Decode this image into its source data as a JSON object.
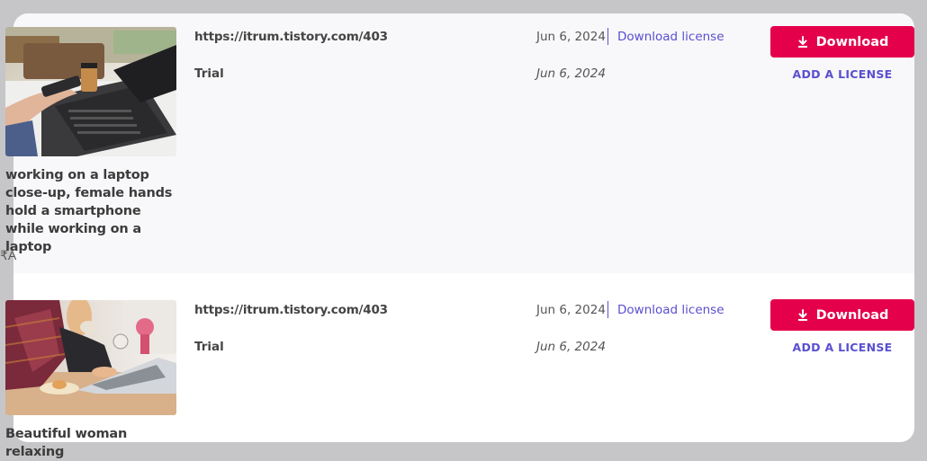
{
  "side_fragment": "₹A",
  "items": [
    {
      "url": "https://itrum.tistory.com/403",
      "date": "Jun 6, 2024",
      "download_license_label": "Download license",
      "license_type": "Trial",
      "license_date": "Jun 6, 2024",
      "download_button_label": "Download",
      "add_license_label": "ADD A LICENSE",
      "caption": "working on a laptop close-up, female hands hold a smartphone while working on a laptop"
    },
    {
      "url": "https://itrum.tistory.com/403",
      "date": "Jun 6, 2024",
      "download_license_label": "Download license",
      "license_type": "Trial",
      "license_date": "Jun 6, 2024",
      "download_button_label": "Download",
      "add_license_label": "ADD A LICENSE",
      "caption": "Beautiful woman relaxing"
    }
  ],
  "colors": {
    "download_button": "#e4004b",
    "link_accent": "#5a4fcf",
    "row_highlight": "#f8f8fa",
    "page_background": "#c6c6c8"
  }
}
